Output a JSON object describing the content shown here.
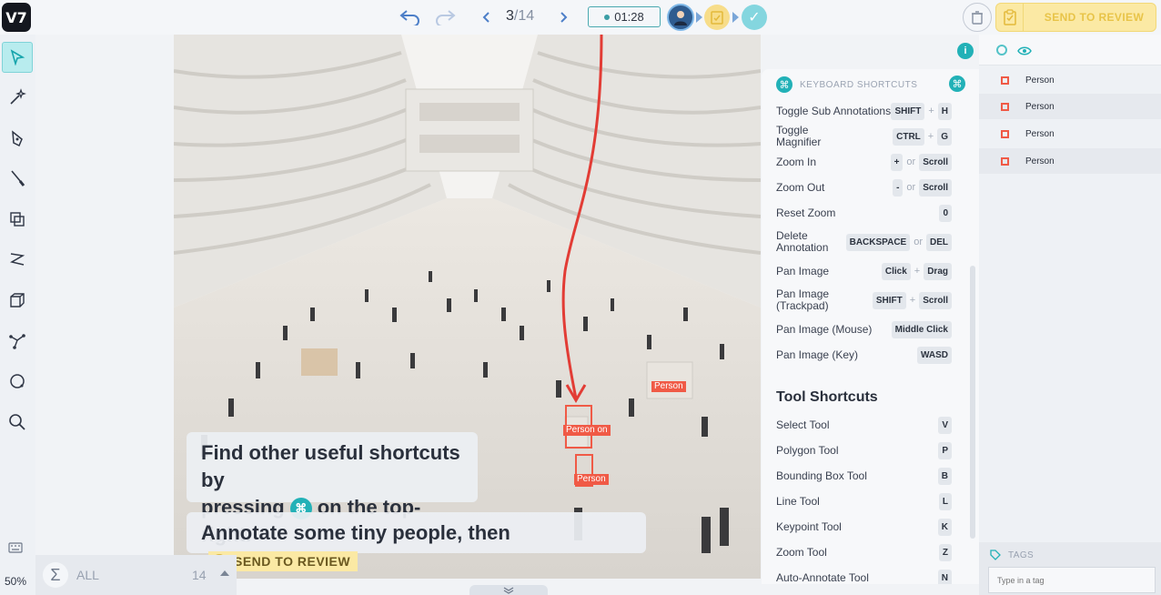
{
  "app": {
    "logo": "V7"
  },
  "topbar": {
    "undo_icon": "undo-icon",
    "redo_icon": "redo-icon",
    "page_current": "3",
    "page_sep": "/",
    "page_total": "14",
    "timer": "01:28",
    "send_to_review": "SEND TO REVIEW"
  },
  "toolbar": {
    "tools": [
      "select",
      "auto-annotate",
      "polygon",
      "brush",
      "bounding-box",
      "polyline",
      "cuboid",
      "keypoint-skeleton",
      "ellipse",
      "zoom"
    ],
    "zoom_level": "50%"
  },
  "canvas": {
    "labels": [
      "Person",
      "Person",
      "Person"
    ],
    "label_extra": "on",
    "tooltip1_line1": "Find other useful shortcuts by",
    "tooltip1_line2_a": "pressing",
    "tooltip1_key": "⌘",
    "tooltip1_line2_b": "on the top-right.",
    "tooltip2_text": "Annotate some tiny people, then",
    "tooltip2_button": "SEND TO REVIEW"
  },
  "filter": {
    "all_label": "ALL",
    "count": "14"
  },
  "shortcuts": {
    "title": "KEYBOARD SHORTCUTS",
    "rows": [
      {
        "name": "Toggle Sub Annotations",
        "keys": [
          "SHIFT",
          "+",
          "H"
        ]
      },
      {
        "name": "Toggle Magnifier",
        "keys": [
          "CTRL",
          "+",
          "G"
        ]
      },
      {
        "name": "Zoom In",
        "keys": [
          "+",
          "or",
          "Scroll"
        ]
      },
      {
        "name": "Zoom Out",
        "keys": [
          "-",
          "or",
          "Scroll"
        ]
      },
      {
        "name": "Reset Zoom",
        "keys": [
          "0"
        ]
      },
      {
        "name": "Delete Annotation",
        "keys": [
          "BACKSPACE",
          "or",
          "DEL"
        ]
      },
      {
        "name": "Pan Image",
        "keys": [
          "Click",
          "+",
          "Drag"
        ]
      },
      {
        "name": "Pan Image (Trackpad)",
        "keys": [
          "SHIFT",
          "+",
          "Scroll"
        ]
      },
      {
        "name": "Pan Image (Mouse)",
        "keys": [
          "Middle Click"
        ]
      },
      {
        "name": "Pan Image (Key)",
        "keys": [
          "WASD"
        ]
      }
    ],
    "tools_section": "Tool Shortcuts",
    "tool_rows": [
      {
        "name": "Select Tool",
        "keys": [
          "V"
        ]
      },
      {
        "name": "Polygon Tool",
        "keys": [
          "P"
        ]
      },
      {
        "name": "Bounding Box Tool",
        "keys": [
          "B"
        ]
      },
      {
        "name": "Line Tool",
        "keys": [
          "L"
        ]
      },
      {
        "name": "Keypoint Tool",
        "keys": [
          "K"
        ]
      },
      {
        "name": "Zoom Tool",
        "keys": [
          "Z"
        ]
      },
      {
        "name": "Auto-Annotate Tool",
        "keys": [
          "N"
        ]
      }
    ]
  },
  "panel": {
    "info_label": "i",
    "annotations": [
      "Person",
      "Person",
      "Person",
      "Person"
    ],
    "tags_label": "TAGS",
    "tag_placeholder": "Type in a tag"
  },
  "colors": {
    "accent": "#22b1b7",
    "annotation": "#f05a46",
    "review": "#fbe9a4"
  }
}
